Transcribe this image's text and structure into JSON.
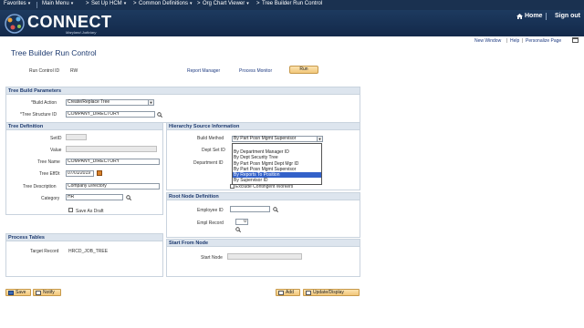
{
  "nav": {
    "items": [
      {
        "label": "Favorites"
      },
      {
        "label": "Main Menu"
      },
      {
        "label": "Set Up HCM"
      },
      {
        "label": "Common Definitions"
      },
      {
        "label": "Org Chart Viewer"
      },
      {
        "label": "Tree Builder Run Control"
      }
    ],
    "separator": ">"
  },
  "header": {
    "logo_text": "CONNECT",
    "logo_sub": "Maryland Judiciary",
    "home_label": "Home",
    "signout_label": "Sign out"
  },
  "util_links": {
    "new_window": "New Window",
    "help": "Help",
    "personalize": "Personalize Page",
    "sep": "|"
  },
  "page": {
    "title": "Tree Builder Run Control",
    "run_control_label": "Run Control ID",
    "run_control_value": "RW",
    "report_manager": "Report Manager",
    "process_monitor": "Process Monitor",
    "run_button": "Run"
  },
  "tree_build": {
    "header": "Tree Build Parameters",
    "build_action_label": "*Build Action",
    "build_action_value": "Create/Replace Tree",
    "tree_structure_label": "*Tree Structure ID",
    "tree_structure_value": "COMPANY_DIRECTORY"
  },
  "tree_definition": {
    "header": "Tree Definition",
    "setid_label": "SetID",
    "value_label": "Value",
    "tree_name_label": "Tree Name",
    "tree_name_value": "COMPANY_DIRECTORY",
    "effdt_label": "Tree EffDt",
    "effdt_value": "07/01/2019",
    "desc_label": "Tree Description",
    "desc_value": "Company Directory",
    "category_label": "Category",
    "category_value": "HR",
    "save_draft_label": "Save As Draft"
  },
  "hierarchy": {
    "header": "Hierarchy Source Information",
    "build_method_label": "Build Method",
    "build_method_value": "By Part Posn Mgmt Supervisor",
    "dept_set_label": "Dept Set ID",
    "department_label": "Department ID",
    "exclude_label": "Exclude Contingent Workers",
    "options": [
      "",
      "By Department Manager ID",
      "By Dept Security Tree",
      "By Part Posn Mgmt Dept Mgr ID",
      "By Part Posn Mgmt Supervisor",
      "By Reports To Position",
      "By Supervisor ID"
    ],
    "highlighted_index": 5
  },
  "root_node": {
    "header": "Root Node Definition",
    "employee_label": "Employee ID",
    "empl_record_label": "Empl Record",
    "empl_record_value": "0"
  },
  "process_tables": {
    "header": "Process Tables",
    "target_label": "Target Record",
    "target_value": "HRCD_JOB_TREE"
  },
  "start_from": {
    "header": "Start From Node",
    "start_node_label": "Start Node"
  },
  "footer": {
    "save": "Save",
    "notify": "Notify",
    "add": "Add",
    "update": "Update/Display"
  }
}
